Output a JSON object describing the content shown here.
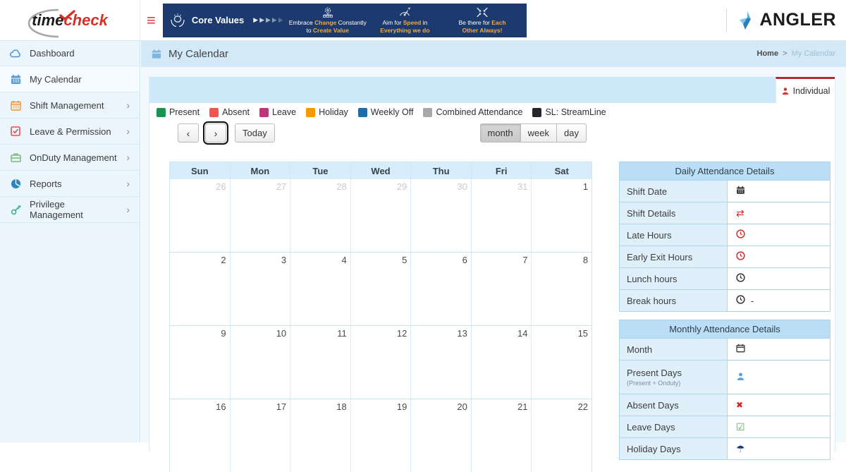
{
  "brand": {
    "time": "time",
    "check": "check",
    "partner": "ANGLER"
  },
  "topbar": {
    "hamburger": "≡",
    "banner": {
      "title": "Core Values",
      "arrows": "▶▶▶▶▶",
      "items": [
        {
          "l1a": "Embrace ",
          "l1b": "Change",
          "l1c": " Constantly",
          "l2a": "to ",
          "l2b": "Create Value"
        },
        {
          "l1a": "Aim for ",
          "l1b": "Speed",
          "l1c": " in",
          "l2a": "",
          "l2b": "Everything we do"
        },
        {
          "l1a": "Be there for ",
          "l1b": "Each",
          "l1c": "",
          "l2a": "",
          "l2b": "Other Always!"
        }
      ]
    }
  },
  "sidebar": {
    "items": [
      {
        "label": "Dashboard",
        "chevron": ""
      },
      {
        "label": "My Calendar",
        "chevron": ""
      },
      {
        "label": "Shift Management",
        "chevron": "›"
      },
      {
        "label": "Leave & Permission",
        "chevron": "›"
      },
      {
        "label": "OnDuty Management",
        "chevron": "›"
      },
      {
        "label": "Reports",
        "chevron": "›"
      },
      {
        "label": "Privilege Management",
        "chevron": "›"
      }
    ]
  },
  "header": {
    "title": "My Calendar",
    "breadcrumb_home": "Home",
    "breadcrumb_sep": ">",
    "breadcrumb_current": "My Calendar"
  },
  "tabs": {
    "individual": "Individual"
  },
  "legend": {
    "items": [
      {
        "label": "Present",
        "color": "#18944e"
      },
      {
        "label": "Absent",
        "color": "#f4544c"
      },
      {
        "label": "Leave",
        "color": "#bd3778"
      },
      {
        "label": "Holiday",
        "color": "#ff9800"
      },
      {
        "label": "Weekly Off",
        "color": "#1f6da8"
      },
      {
        "label": "Combined Attendance",
        "color": "#a8a8a8"
      },
      {
        "label": "SL: StreamLine",
        "color": "#26262e"
      }
    ]
  },
  "toolbar": {
    "prev": "‹",
    "next": "›",
    "today": "Today",
    "views": [
      "month",
      "week",
      "day"
    ],
    "active_view": "month"
  },
  "calendar": {
    "day_headers": [
      "Sun",
      "Mon",
      "Tue",
      "Wed",
      "Thu",
      "Fri",
      "Sat"
    ],
    "weeks": [
      [
        {
          "d": "26",
          "muted": true
        },
        {
          "d": "27",
          "muted": true
        },
        {
          "d": "28",
          "muted": true
        },
        {
          "d": "29",
          "muted": true
        },
        {
          "d": "30",
          "muted": true
        },
        {
          "d": "31",
          "muted": true
        },
        {
          "d": "1"
        }
      ],
      [
        {
          "d": "2"
        },
        {
          "d": "3"
        },
        {
          "d": "4"
        },
        {
          "d": "5"
        },
        {
          "d": "6"
        },
        {
          "d": "7"
        },
        {
          "d": "8"
        }
      ],
      [
        {
          "d": "9"
        },
        {
          "d": "10"
        },
        {
          "d": "11"
        },
        {
          "d": "12"
        },
        {
          "d": "13"
        },
        {
          "d": "14"
        },
        {
          "d": "15"
        }
      ],
      [
        {
          "d": "16"
        },
        {
          "d": "17"
        },
        {
          "d": "18"
        },
        {
          "d": "19"
        },
        {
          "d": "20"
        },
        {
          "d": "21"
        },
        {
          "d": "22"
        }
      ]
    ]
  },
  "daily": {
    "title": "Daily Attendance Details",
    "rows": [
      {
        "label": "Shift Date",
        "value": ""
      },
      {
        "label": "Shift Details",
        "value": ""
      },
      {
        "label": "Late Hours",
        "value": ""
      },
      {
        "label": "Early Exit Hours",
        "value": ""
      },
      {
        "label": "Lunch hours",
        "value": ""
      },
      {
        "label": "Break hours",
        "value": "-"
      }
    ]
  },
  "monthly": {
    "title": "Monthly Attendance Details",
    "rows": [
      {
        "label": "Month",
        "sublabel": "",
        "value": ""
      },
      {
        "label": "Present Days",
        "sublabel": "(Present + Onduty)",
        "value": ""
      },
      {
        "label": "Absent Days",
        "sublabel": "",
        "value": ""
      },
      {
        "label": "Leave Days",
        "sublabel": "",
        "value": ""
      },
      {
        "label": "Holiday Days",
        "sublabel": "",
        "value": ""
      }
    ]
  }
}
